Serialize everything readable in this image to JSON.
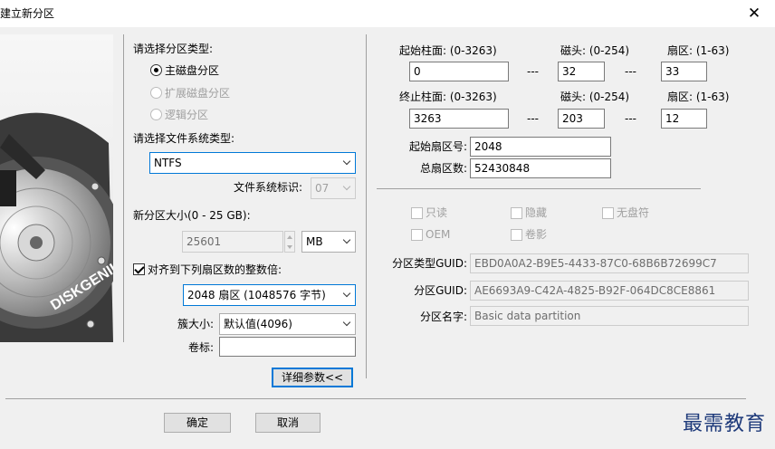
{
  "window": {
    "title": "建立新分区",
    "close_glyph": "✕"
  },
  "left_panel": {
    "partition_type_label": "请选择分区类型:",
    "partition_types": [
      {
        "label": "主磁盘分区",
        "checked": true,
        "enabled": true
      },
      {
        "label": "扩展磁盘分区",
        "checked": false,
        "enabled": false
      },
      {
        "label": "逻辑分区",
        "checked": false,
        "enabled": false
      }
    ],
    "fs_type_label": "请选择文件系统类型:",
    "fs_type_value": "NTFS",
    "fs_id_label": "文件系统标识:",
    "fs_id_value": "07",
    "size_label": "新分区大小(0 - 25 GB):",
    "size_value": "25601",
    "size_unit": "MB",
    "align_label": "对齐到下列扇区数的整数倍:",
    "align_checked": true,
    "align_value": "2048 扇区 (1048576 字节)",
    "cluster_label": "簇大小:",
    "cluster_value": "默认值(4096)",
    "volume_label": "卷标:",
    "volume_value": "",
    "detail_button": "详细参数<<"
  },
  "geometry": {
    "start_cyl_label": "起始柱面: (0-3263)",
    "head_label": "磁头: (0-254)",
    "sector_label": "扇区: (1-63)",
    "start_cyl": "0",
    "start_head": "32",
    "start_sector": "33",
    "end_cyl_label": "终止柱面: (0-3263)",
    "end_cyl": "3263",
    "end_head": "203",
    "end_sector": "12",
    "dash": "---",
    "start_lba_label": "起始扇区号:",
    "start_lba": "2048",
    "total_sectors_label": "总扇区数:",
    "total_sectors": "52430848"
  },
  "attributes": {
    "readonly": "只读",
    "hidden": "隐藏",
    "no_letter": "无盘符",
    "oem": "OEM",
    "shadow": "卷影"
  },
  "guid": {
    "type_guid_label": "分区类型GUID:",
    "type_guid": "EBD0A0A2-B9E5-4433-87C0-68B6B72699C7",
    "part_guid_label": "分区GUID:",
    "part_guid": "AE6693A9-C42A-4825-B92F-064DC8CE8861",
    "name_label": "分区名字:",
    "name": "Basic data partition"
  },
  "buttons": {
    "ok": "确定",
    "cancel": "取消"
  },
  "artwork": {
    "disk_brand": "DISKGENIUS"
  },
  "watermark": "最需教育"
}
